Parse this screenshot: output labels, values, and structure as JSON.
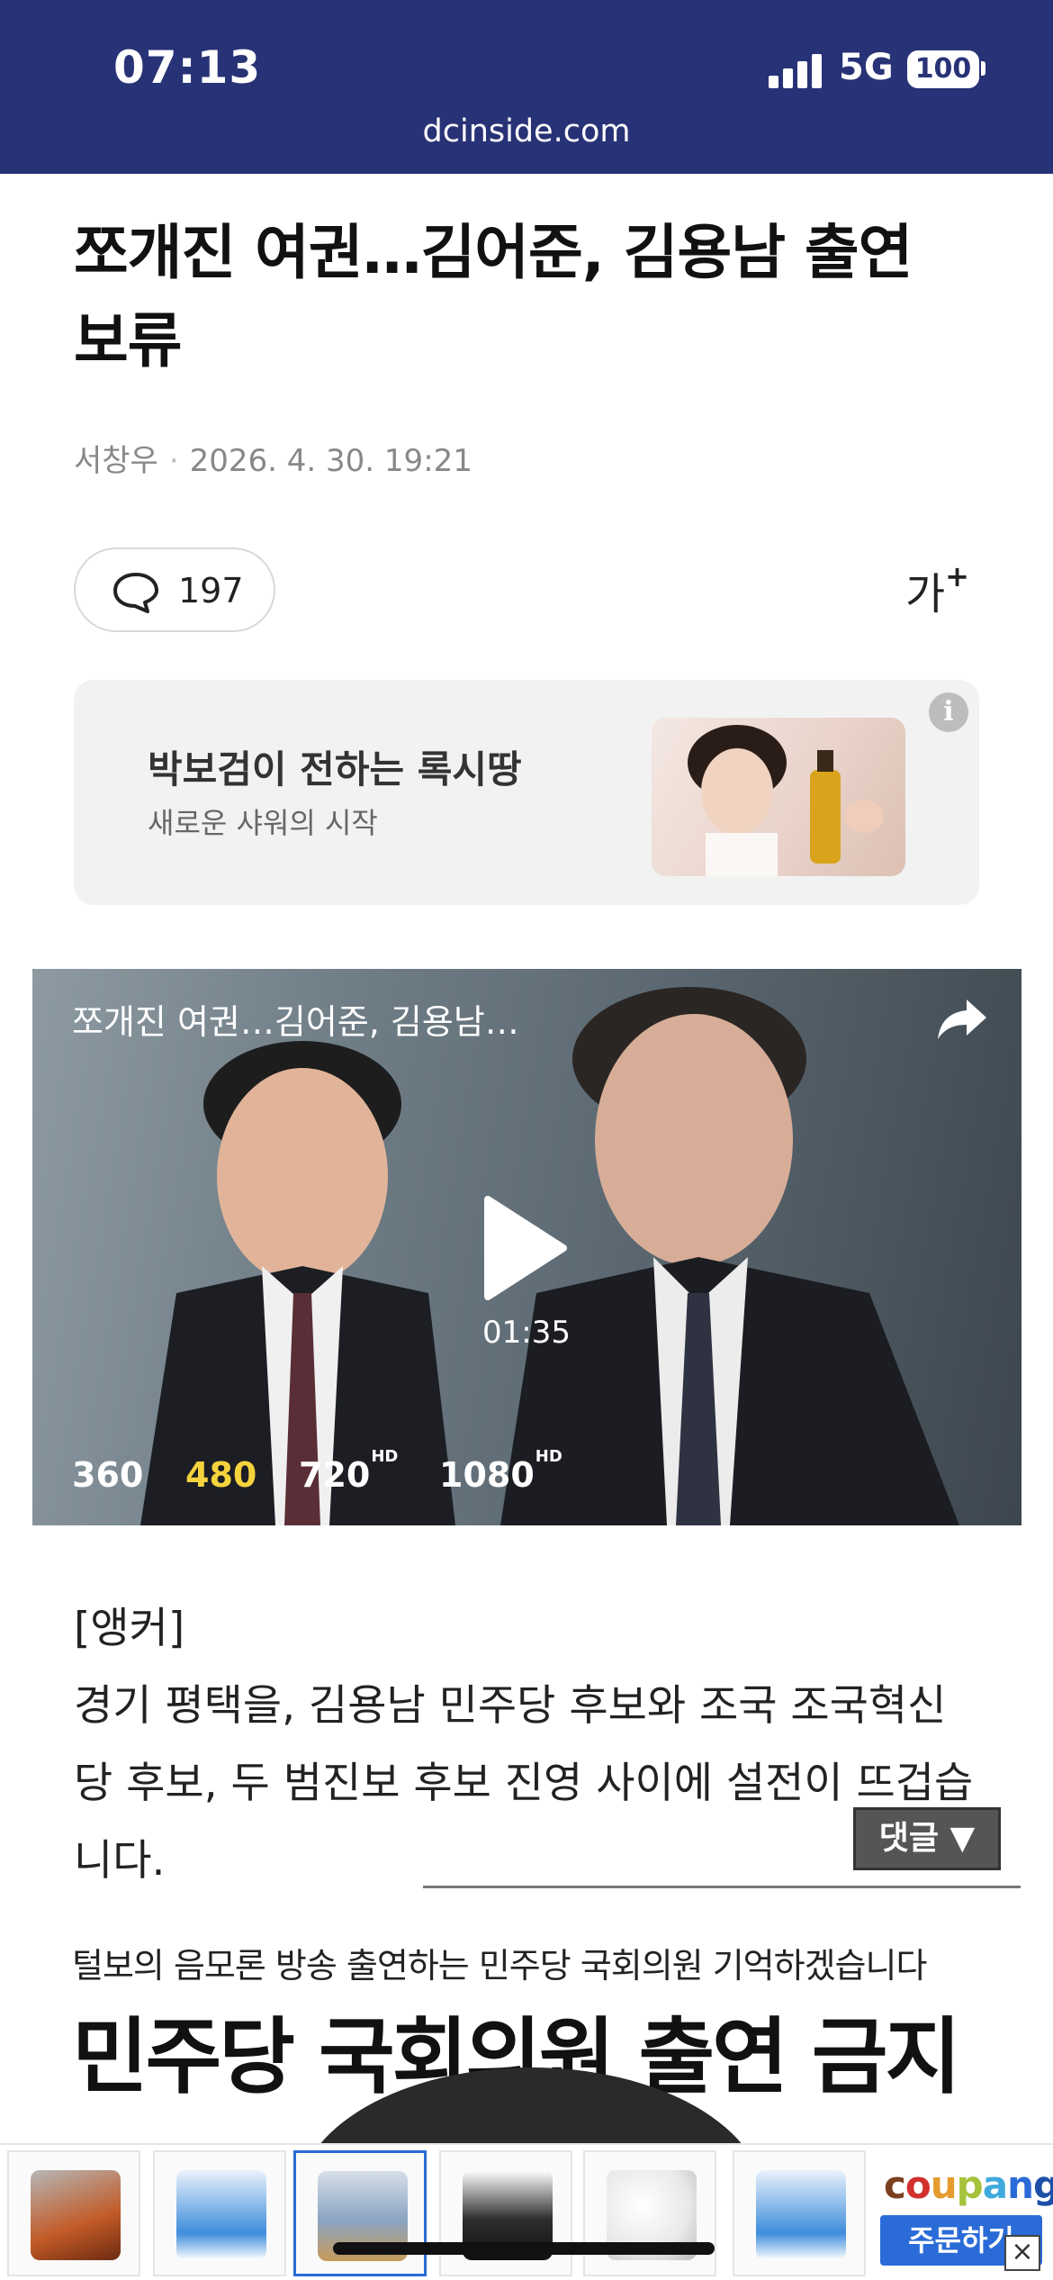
{
  "status_bar": {
    "time": "07:13",
    "network": "5G",
    "battery": "100"
  },
  "browser": {
    "url": "dcinside.com"
  },
  "article": {
    "headline": "쪼개진 여권…김어준, 김용남 출연 보류",
    "author": "서창우",
    "datetime": "2026. 4. 30. 19:21",
    "comment_count": "197",
    "font_size_label": "가",
    "font_size_plus": "+"
  },
  "ad": {
    "title": "박보검이 전하는 록시땅",
    "subtitle": "새로운 샤워의 시작",
    "info_icon": "i"
  },
  "video": {
    "title": "쪼개진 여권…김어준, 김용남…",
    "duration": "01:35",
    "qualities": [
      {
        "label": "360",
        "hd": ""
      },
      {
        "label": "480",
        "hd": ""
      },
      {
        "label": "720",
        "hd": "HD"
      },
      {
        "label": "1080",
        "hd": "HD"
      }
    ],
    "selected_quality": "480"
  },
  "body": {
    "anchor_label": "[앵커]",
    "paragraph": "경기 평택을, 김용남 민주당 후보와 조국 조국혁신당 후보, 두 범진보 후보 진영 사이에 설전이 뜨겁습니다."
  },
  "reply_button": "댓글 ▼",
  "embedded_image": {
    "top_text": "털보의 음모론 방송 출연하는 민주당 국회의원 기억하겠습니다",
    "main_text": "민주당 국회의원 출연 금지"
  },
  "ad_strip": {
    "brand": "coupang",
    "order_button": "주문하기",
    "close_icon": "×"
  },
  "colors": {
    "header_bg": "#283276",
    "quality_selected": "#f5d33c",
    "coupang_blue": "#2a6bd8"
  }
}
